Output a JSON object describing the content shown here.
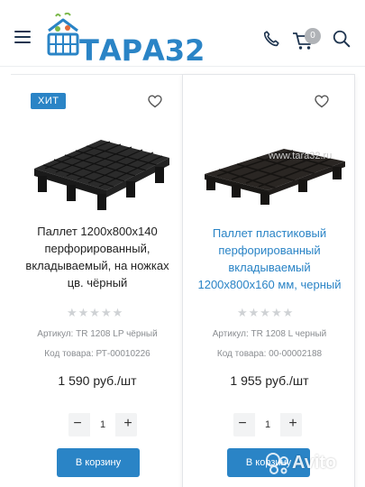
{
  "header": {
    "logo_text": "ТАРА32",
    "cart_count": "0",
    "icons": [
      "menu-icon",
      "phone-icon",
      "cart-icon",
      "search-icon"
    ]
  },
  "products": [
    {
      "badge": "ХИТ",
      "title": "Паллет 1200х800х140 перфорированный, вкладываемый, на ножках цв. чёрный",
      "rating_stars": "★★★★★",
      "sku": "Артикул: TR 1208 LP чёрный",
      "code": "Код товара: РТ-00010226",
      "price": "1 590 руб./шт",
      "qty": "1",
      "qty_minus": "−",
      "qty_plus": "+",
      "button": "В корзину"
    },
    {
      "title": "Паллет пластиковый перфорированный вкладываемый 1200x800x160 мм, черный",
      "watermark": "www.tara32.ru",
      "rating_stars": "★★★★★",
      "sku": "Артикул: TR 1208 L черный",
      "code": "Код товара: 00-00002188",
      "price": "1 955 руб./шт",
      "qty": "1",
      "qty_minus": "−",
      "qty_plus": "+",
      "button": "В корзину"
    }
  ],
  "overlay": {
    "avito_text": "Avito"
  },
  "colors": {
    "accent": "#2a84c6",
    "badge_bg": "#b0b3b7",
    "dark": "#1f3550"
  }
}
